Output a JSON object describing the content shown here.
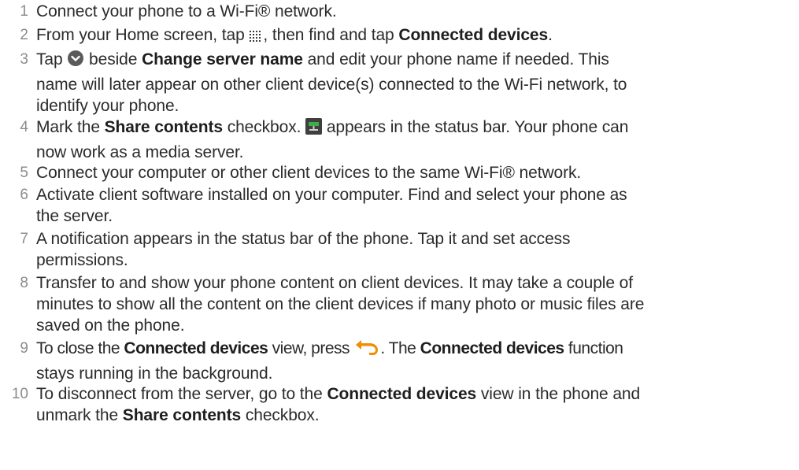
{
  "steps": [
    {
      "number": "1",
      "parts": [
        "Connect your phone to a Wi-Fi® network."
      ]
    },
    {
      "number": "2",
      "parts": [
        "From your Home screen, tap ",
        ", then find and tap ",
        "Connected devices",
        "."
      ]
    },
    {
      "number": "3",
      "parts": [
        "Tap ",
        " beside ",
        "Change server name",
        " and edit your phone name if needed. This",
        "name will later appear on other client device(s) connected to the Wi-Fi network, to",
        "identify your phone."
      ]
    },
    {
      "number": "4",
      "parts": [
        "Mark the ",
        "Share contents",
        " checkbox. ",
        " appears in the status bar. Your phone can",
        "now work as a media server."
      ]
    },
    {
      "number": "5",
      "parts": [
        "Connect your computer or other client devices to the same Wi-Fi® network."
      ]
    },
    {
      "number": "6",
      "parts": [
        "Activate client software installed on your computer. Find and select your phone as",
        "the server."
      ]
    },
    {
      "number": "7",
      "parts": [
        "A notification appears in the status bar of the phone. Tap it and set access",
        "permissions."
      ]
    },
    {
      "number": "8",
      "parts": [
        "Transfer to and show your phone content on client devices. It may take a couple of",
        "minutes to show all the content on the client devices if many photo or music files are",
        "saved on the phone."
      ]
    },
    {
      "number": "9",
      "parts": [
        "To close the ",
        "Connected devices",
        " view, press ",
        ". The ",
        "Connected devices",
        " function",
        "stays running in the background."
      ]
    },
    {
      "number": "10",
      "parts": [
        "To disconnect from the server, go to the ",
        "Connected devices",
        " view in the phone and",
        "unmark the ",
        "Share contents",
        " checkbox."
      ]
    }
  ],
  "icons": {
    "app_grid": "app-grid-icon",
    "expand": "expand-chevron-icon",
    "media_server": "media-server-status-icon",
    "back": "back-arrow-icon"
  },
  "colors": {
    "number": "#8c8c8c",
    "text": "#2b2b2b",
    "back_arrow": "#f28c00",
    "expand_circle": "#5a5a5a"
  }
}
